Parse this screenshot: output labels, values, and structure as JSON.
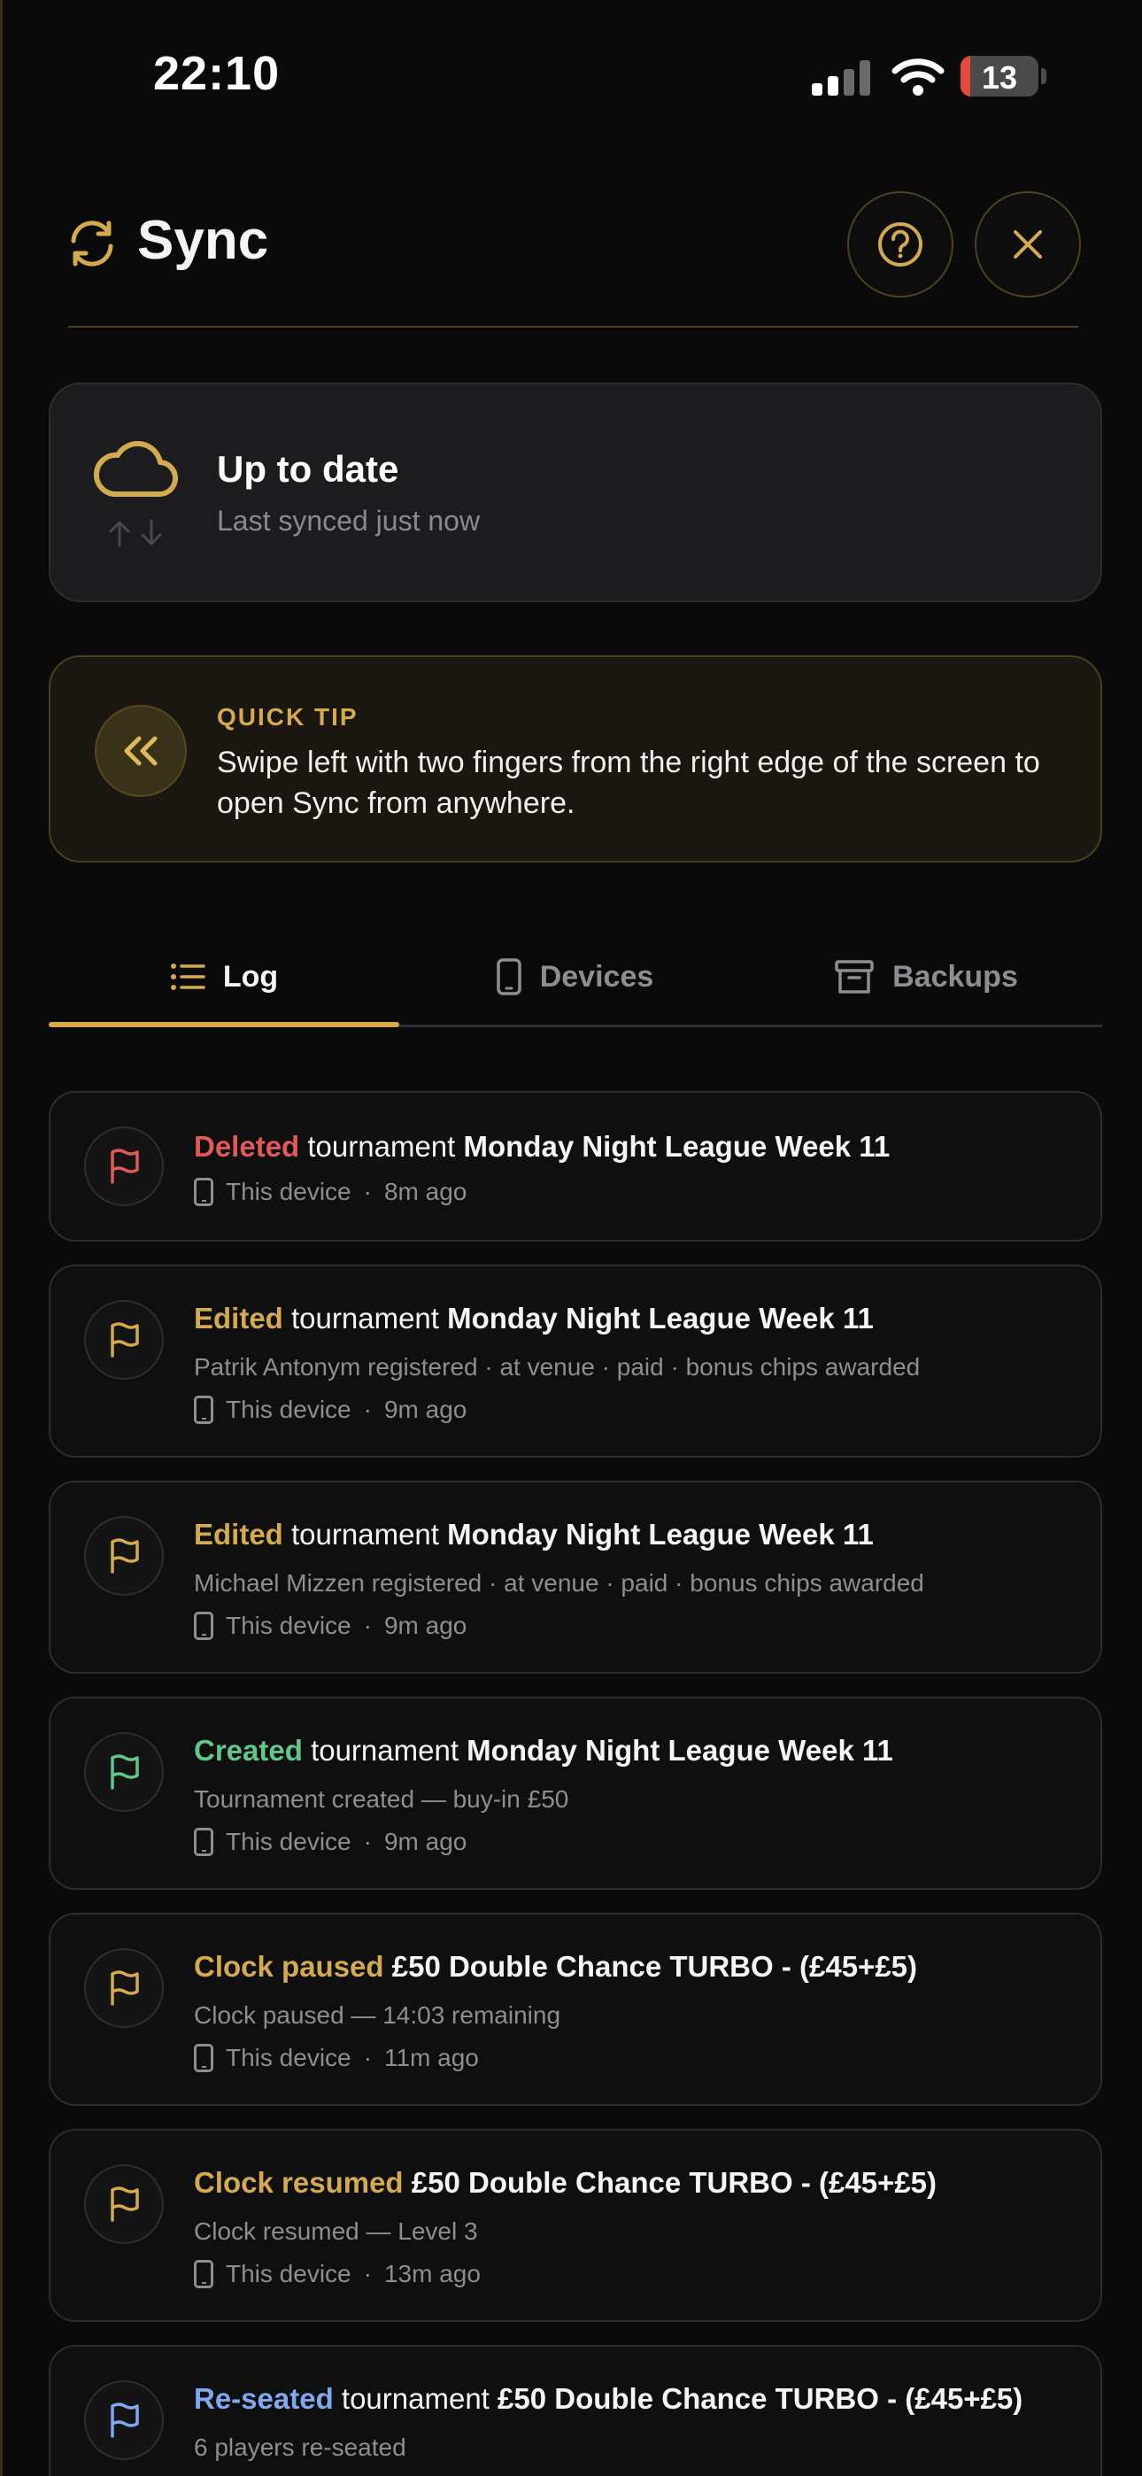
{
  "status_bar": {
    "time": "22:10",
    "battery_level": "13",
    "battery_fraction": 0.13
  },
  "header": {
    "title": "Sync",
    "icon": "sync-icon",
    "help_icon": "question-circle-icon",
    "close_icon": "close-icon"
  },
  "status_card": {
    "icon": "cloud-icon",
    "title": "Up to date",
    "subtitle": "Last synced just now"
  },
  "tip": {
    "label": "QUICK TIP",
    "text": "Swipe left with two fingers from the right edge of the screen to open Sync from anywhere.",
    "icon": "chevrons-left-icon"
  },
  "tabs": [
    {
      "label": "Log",
      "icon": "list-icon",
      "active": true
    },
    {
      "label": "Devices",
      "icon": "phone-icon",
      "active": false
    },
    {
      "label": "Backups",
      "icon": "archive-icon",
      "active": false
    }
  ],
  "colors": {
    "accent": "#d4aa4e",
    "deleted": "#e05a5a",
    "edited": "#d4aa4e",
    "created": "#5fc88a",
    "reseated": "#7fa8f0"
  },
  "log": [
    {
      "verb": "Deleted",
      "verb_color": "#e05a5a",
      "object": "tournament",
      "name": "Monday Night League Week 11",
      "detail": "",
      "device": "This device",
      "time": "8m ago",
      "flag_color": "#e05a5a"
    },
    {
      "verb": "Edited",
      "verb_color": "#d4aa4e",
      "object": "tournament",
      "name": "Monday Night League Week 11",
      "detail": "Patrik Antonym registered · at venue · paid · bonus chips awarded",
      "device": "This device",
      "time": "9m ago",
      "flag_color": "#d4aa4e"
    },
    {
      "verb": "Edited",
      "verb_color": "#d4aa4e",
      "object": "tournament",
      "name": "Monday Night League Week 11",
      "detail": "Michael Mizzen registered · at venue · paid · bonus chips awarded",
      "device": "This device",
      "time": "9m ago",
      "flag_color": "#d4aa4e"
    },
    {
      "verb": "Created",
      "verb_color": "#5fc88a",
      "object": "tournament",
      "name": "Monday Night League Week 11",
      "detail": "Tournament created — buy-in £50",
      "device": "This device",
      "time": "9m ago",
      "flag_color": "#5fc88a"
    },
    {
      "verb": "Clock paused",
      "verb_color": "#d4aa4e",
      "object": "",
      "name": "£50 Double Chance TURBO - (£45+£5)",
      "detail": "Clock paused — 14:03 remaining",
      "device": "This device",
      "time": "11m ago",
      "flag_color": "#d4aa4e"
    },
    {
      "verb": "Clock resumed",
      "verb_color": "#d4aa4e",
      "object": "",
      "name": "£50 Double Chance TURBO - (£45+£5)",
      "detail": "Clock resumed — Level 3",
      "device": "This device",
      "time": "13m ago",
      "flag_color": "#d4aa4e"
    },
    {
      "verb": "Re-seated",
      "verb_color": "#7fa8f0",
      "object": "tournament",
      "name": "£50 Double Chance TURBO - (£45+£5)",
      "detail": "6 players re-seated",
      "device": "",
      "time": "",
      "flag_color": "#7fa8f0"
    }
  ]
}
